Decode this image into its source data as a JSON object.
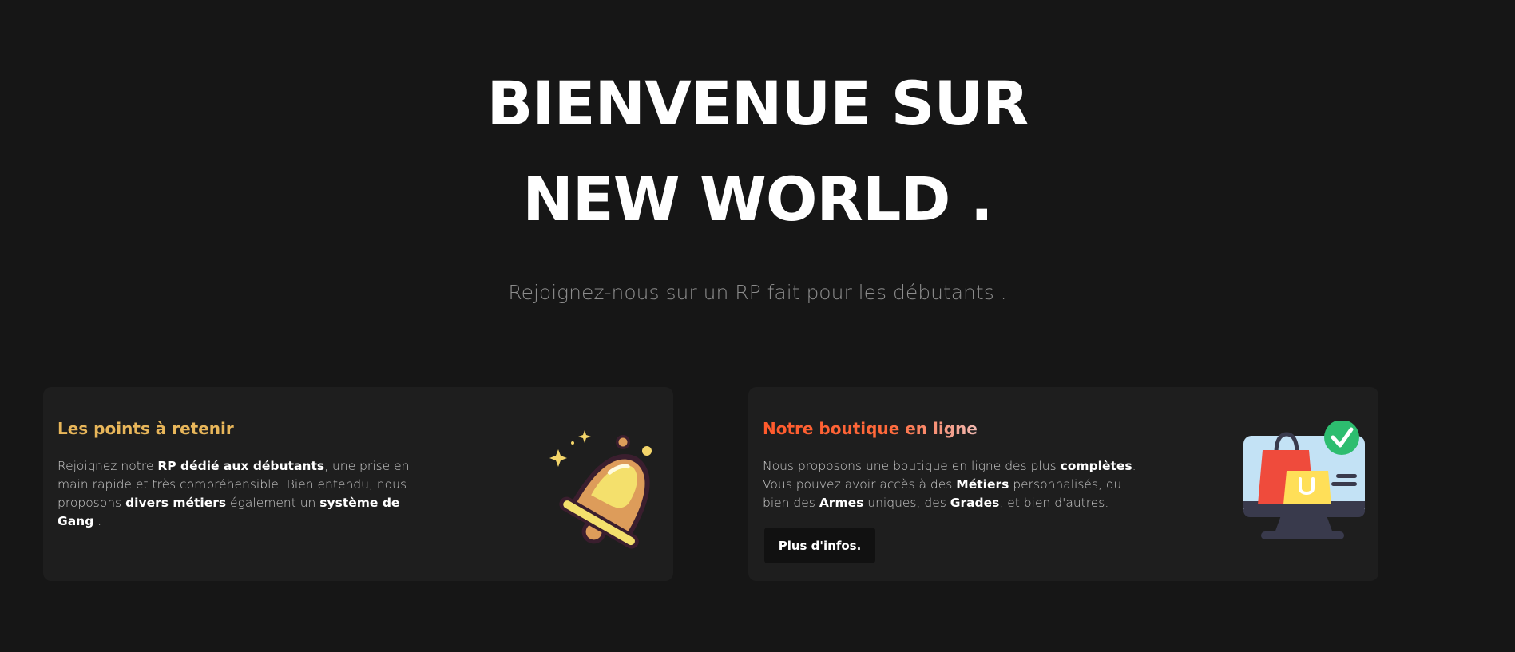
{
  "hero": {
    "title_line1": "BIENVENUE SUR",
    "title_line2": "NEW WORLD .",
    "subtitle": "Rejoignez-nous sur un RP fait pour les débutants ."
  },
  "cards": [
    {
      "title": "Les points à retenir",
      "text": [
        {
          "t": "Rejoignez notre ",
          "b": false
        },
        {
          "t": "RP dédié aux débutants",
          "b": true
        },
        {
          "t": ", une prise en main rapide et très compréhensible. Bien entendu, nous proposons ",
          "b": false
        },
        {
          "t": "divers métiers",
          "b": true
        },
        {
          "t": " également un ",
          "b": false
        },
        {
          "t": "système de Gang",
          "b": true
        },
        {
          "t": " .",
          "b": false
        }
      ],
      "icon": "bell-icon"
    },
    {
      "title": "Notre boutique en ligne",
      "text": [
        {
          "t": "Nous proposons une boutique en ligne des plus ",
          "b": false
        },
        {
          "t": "complètes",
          "b": true
        },
        {
          "t": ". Vous pouvez avoir accès à des ",
          "b": false
        },
        {
          "t": "Métiers",
          "b": true
        },
        {
          "t": " personnalisés, ou bien des ",
          "b": false
        },
        {
          "t": "Armes",
          "b": true
        },
        {
          "t": " uniques, des ",
          "b": false
        },
        {
          "t": "Grades",
          "b": true
        },
        {
          "t": ", et bien d'autres.",
          "b": false
        }
      ],
      "button_label": "Plus d'infos.",
      "icon": "shopping-monitor-icon"
    }
  ],
  "colors": {
    "background": "#161616",
    "card": "#1e1e1e",
    "accent_gold": "#e8b65a",
    "accent_orange": "#ff5a2c"
  }
}
